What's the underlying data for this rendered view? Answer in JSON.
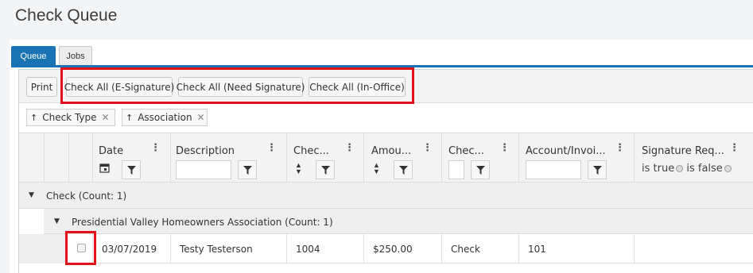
{
  "page": {
    "title": "Check Queue"
  },
  "tabs": [
    {
      "label": "Queue",
      "active": true
    },
    {
      "label": "Jobs",
      "active": false
    }
  ],
  "toolbar": {
    "print": "Print",
    "check_all_esig": "Check All (E-Signature)",
    "check_all_need_sig": "Check All (Need Signature)",
    "check_all_in_office": "Check All (In-Office)"
  },
  "grouping": {
    "chips": [
      {
        "label": "Check Type",
        "arrow": "↑",
        "remove": "✕"
      },
      {
        "label": "Association",
        "arrow": "↑",
        "remove": "✕"
      }
    ]
  },
  "columns": {
    "date": "Date",
    "description": "Description",
    "check_num": "Chec...",
    "amount": "Amou...",
    "check_type": "Chec...",
    "account": "Account/Invoi...",
    "signature": "Signature Req...",
    "menu_glyph": "⋮"
  },
  "signature_filter": {
    "true_label": "is true",
    "false_label": "is false"
  },
  "groups": {
    "level1": "Check (Count: 1)",
    "level2": "Presidential Valley Homeowners Association (Count: 1)",
    "caret": "▼"
  },
  "rows": [
    {
      "date": "03/07/2019",
      "description": "Testy Testerson",
      "check_number": "1004",
      "amount": "$250.00",
      "type": "Check",
      "account": "101",
      "signature": ""
    }
  ],
  "colors": {
    "accent": "#1a74b4",
    "highlight": "#e3111b",
    "header_bg": "#f3f3f3",
    "group_bg": "#eeeeee"
  }
}
